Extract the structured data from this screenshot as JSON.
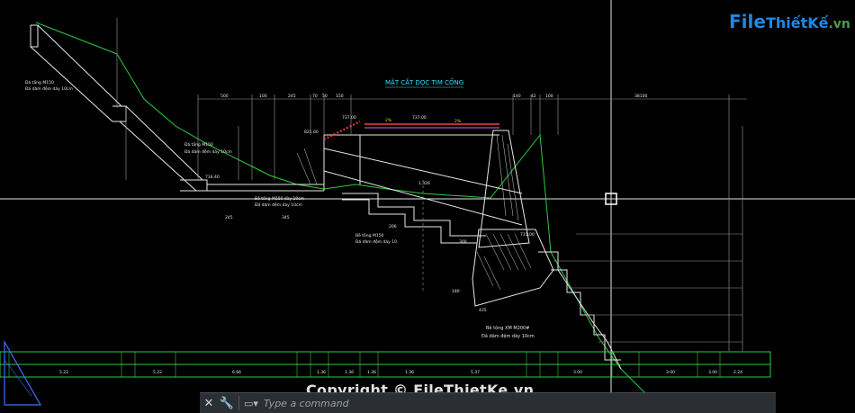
{
  "drawing": {
    "title": "MẶT CẮT DỌC TIM CỐNG",
    "annotations": [
      {
        "id": "note-top-left",
        "text": "Đá tầng M150"
      },
      {
        "id": "note-top-left-2",
        "text": "Đá dăm đệm dày 10cm"
      },
      {
        "id": "note-mid-left",
        "text": "Đá tầng M150"
      },
      {
        "id": "note-mid-left-2",
        "text": "Đá dăm đệm dày 10cm"
      },
      {
        "id": "note-bottom-left",
        "text": "Bê tông M150 dày 10cm"
      },
      {
        "id": "note-bottom-left-2",
        "text": "Đá dăm đệm dày 10cm"
      },
      {
        "id": "note-mid",
        "text": "Bê tông M150"
      },
      {
        "id": "note-mid-2",
        "text": "Đá dăm đệm dày 10"
      },
      {
        "id": "note-main",
        "text": "Bê tông XM M200#"
      },
      {
        "id": "note-main-2",
        "text": "Đá dăm đệm dày 10cm"
      }
    ],
    "dims_top": [
      "500",
      "100",
      "245",
      "70",
      "50",
      "150",
      "140",
      "42",
      "100",
      "38100"
    ],
    "dims_misc": [
      "737.00",
      "737.00",
      "821.00",
      "2%",
      "2%",
      "734.40",
      "1.326",
      "206",
      "245",
      "345",
      "300",
      "435",
      "180",
      "731.00"
    ],
    "strip_values": [
      "5.22",
      "5.22",
      "6.66",
      "1.36",
      "1.36",
      "1.36",
      "1.36",
      "5.37",
      "3.00",
      "3.00",
      "3.00",
      "2.24"
    ]
  },
  "command_line": {
    "placeholder": "Type a command",
    "close_icon": "close-icon",
    "customize_icon": "wrench-icon"
  },
  "watermark": {
    "logo_part1": "File",
    "logo_part2": "ThiếtKế",
    "logo_part3": ".vn",
    "copyright": "Copyright © FileThietKe.vn"
  }
}
